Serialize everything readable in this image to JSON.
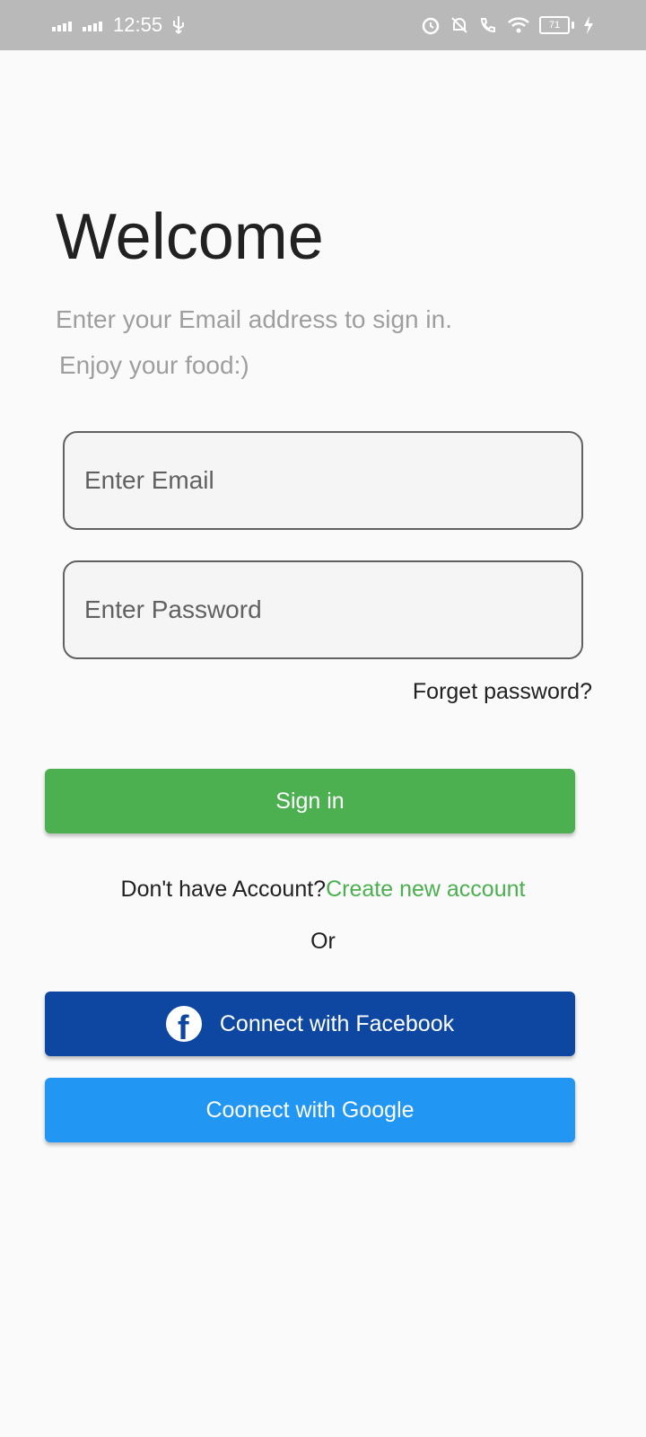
{
  "status_bar": {
    "time": "12:55",
    "battery_level": "71"
  },
  "login": {
    "title": "Welcome",
    "subtitle_line1": "Enter your Email address to sign in.",
    "subtitle_line2": "Enjoy your food:)",
    "email_placeholder": "Enter Email",
    "email_value": "",
    "password_placeholder": "Enter Password",
    "password_value": "",
    "forget_password": "Forget password?",
    "signin_label": "Sign in",
    "no_account_text": "Don't have Account?",
    "create_account_link": "Create new account",
    "or_text": "Or",
    "facebook_label": "Connect with Facebook",
    "google_label": "Coonect with Google"
  },
  "colors": {
    "status_bar": "#b9b9b9",
    "background": "#fafafa",
    "signin_green": "#4caf50",
    "facebook_blue": "#0d47a1",
    "google_blue": "#2196f3",
    "subtitle_gray": "#9e9e9e"
  },
  "icons": {
    "facebook": "facebook-icon"
  }
}
